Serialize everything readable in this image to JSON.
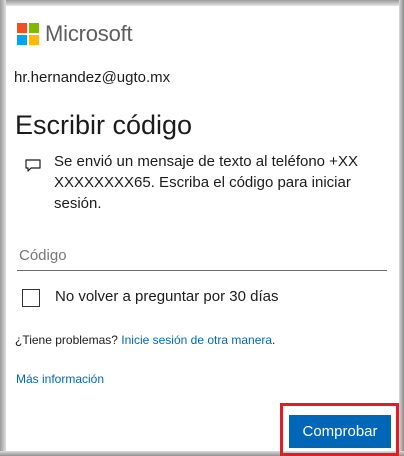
{
  "brand": {
    "name": "Microsoft"
  },
  "account": {
    "email": "hr.hernandez@ugto.mx"
  },
  "page": {
    "title": "Escribir código",
    "message": "Se envió un mensaje de texto al teléfono +XX XXXXXXXX65. Escriba el código para iniciar sesión."
  },
  "code_field": {
    "placeholder": "Código",
    "value": ""
  },
  "remember": {
    "label": "No volver a preguntar por 30 días",
    "checked": false
  },
  "help": {
    "prefix": "¿Tiene problemas?",
    "alt_signin_link": "Inicie sesión de otra manera",
    "suffix": ".",
    "more_info_link": "Más información"
  },
  "actions": {
    "submit_label": "Comprobar"
  },
  "colors": {
    "accent": "#0067b8",
    "highlight": "#e31b23",
    "logo_red": "#f25022",
    "logo_green": "#7fba00",
    "logo_blue": "#00a4ef",
    "logo_yellow": "#ffb900"
  }
}
